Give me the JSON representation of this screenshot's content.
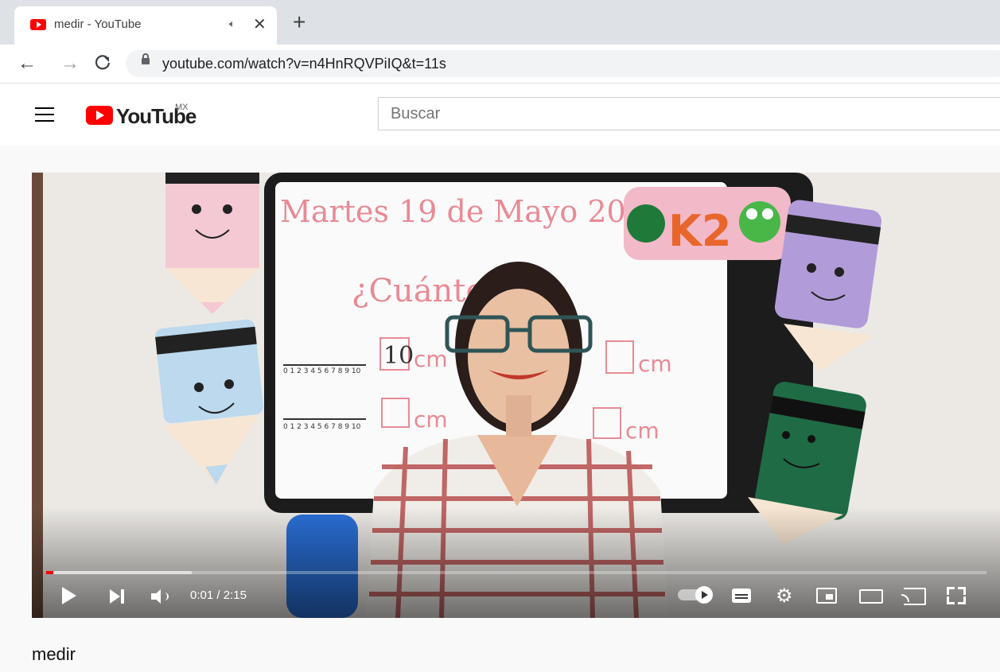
{
  "browser": {
    "tab": {
      "title": "medir - YouTube",
      "audio_icon": "audio-playing-icon",
      "close_label": "✕"
    },
    "new_tab_label": "+",
    "nav": {
      "back_label": "←",
      "forward_label": "→",
      "reload_label": "C"
    },
    "url": "youtube.com/watch?v=n4HnRQVPiIQ&t=11s"
  },
  "youtube": {
    "logo_text": "YouTube",
    "region": "MX",
    "search": {
      "placeholder": "Buscar"
    }
  },
  "video": {
    "frame": {
      "board_heading": "Martes 19 de Mayo 2020",
      "board_question": "¿Cuánto",
      "board_measure_1_value": "10",
      "board_unit": "cm",
      "sign_text": "K2",
      "ruler_ticks_1": "0 1 2 3 4 5 6 7 8 9 10",
      "ruler_ticks_2": "0 1 2 3 4 5 6 7 8 9 10"
    },
    "player": {
      "current_time": "0:01",
      "duration": "2:15",
      "time_separator": " / ",
      "played_fraction": 0.0074,
      "buffered_fraction": 0.155,
      "settings_glyph": "⚙"
    },
    "title": "medir"
  },
  "colors": {
    "youtube_red": "#ff0000",
    "tab_strip": "#dee1e6",
    "omnibox": "#f1f3f4",
    "page_bg": "#f9f9f9"
  }
}
